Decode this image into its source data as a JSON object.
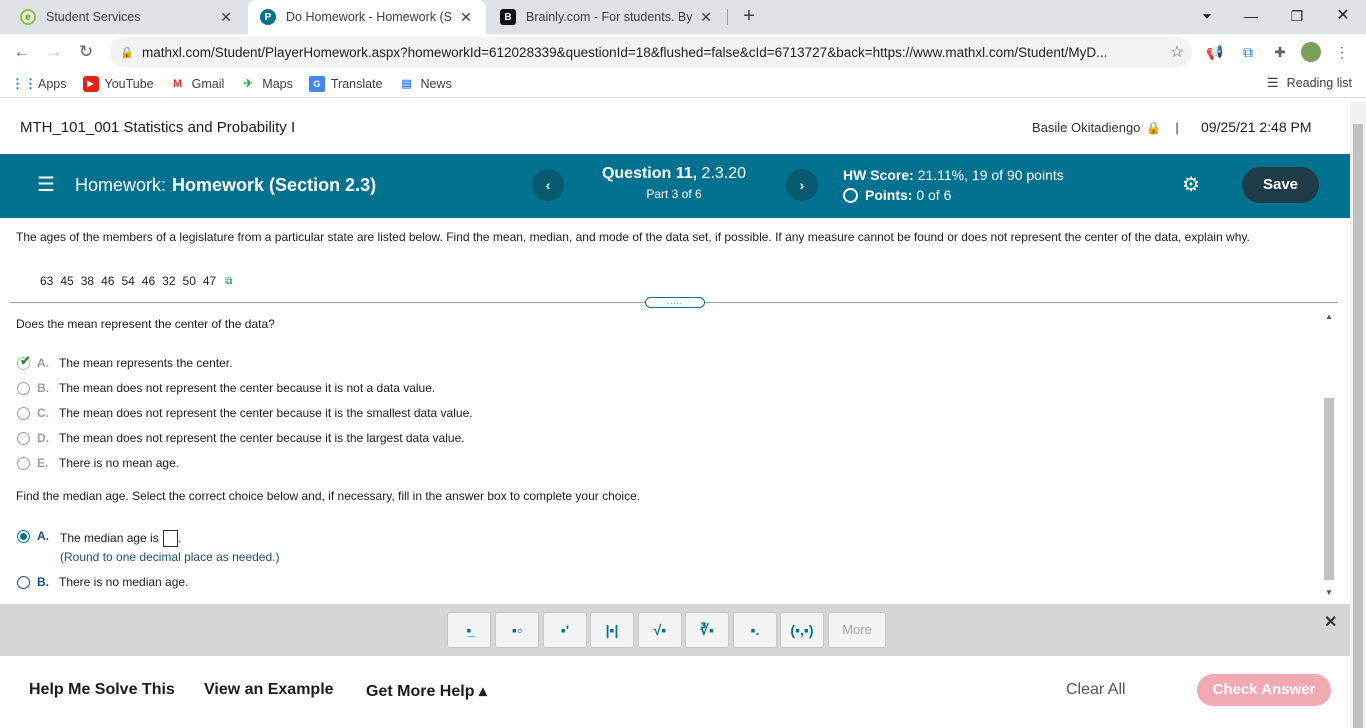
{
  "browser": {
    "tabs": [
      {
        "title": "Student Services",
        "favicon": "e"
      },
      {
        "title": "Do Homework - Homework (Sect",
        "favicon": "P"
      },
      {
        "title": "Brainly.com - For students. By stu",
        "favicon": "B"
      }
    ],
    "url": "mathxl.com/Student/PlayerHomework.aspx?homeworkId=612028339&questionId=18&flushed=false&cId=6713727&back=https://www.mathxl.com/Student/MyD...",
    "bookmarks": [
      "Apps",
      "YouTube",
      "Gmail",
      "Maps",
      "Translate",
      "News"
    ],
    "reading_list": "Reading list"
  },
  "header": {
    "course": "MTH_101_001 Statistics and Probability I",
    "user": "Basile Okitadiengo",
    "separator": "|",
    "datetime": "09/25/21 2:48 PM"
  },
  "hwbar": {
    "label": "Homework:",
    "name": "Homework (Section 2.3)",
    "question_label": "Question 11,",
    "question_ref": "2.3.20",
    "part": "Part 3 of 6",
    "score_label": "HW Score:",
    "score_value": "21.11%, 19 of 90 points",
    "points_label": "Points:",
    "points_value": "0 of 6",
    "save": "Save"
  },
  "question": {
    "text": "The ages of the members of a legislature from a particular state are listed below. Find the mean, median, and mode of the data set, if possible. If any measure cannot be found or does not represent the center of the data, explain why.",
    "data": [
      "63",
      "45",
      "38",
      "46",
      "54",
      "46",
      "32",
      "50",
      "47"
    ],
    "handle": "....."
  },
  "part_mean": {
    "prompt": "Does the mean represent the center of the data?",
    "choices": [
      {
        "letter": "A.",
        "text": "The mean represents the center."
      },
      {
        "letter": "B.",
        "text": "The mean does not represent the center because it is not a data value."
      },
      {
        "letter": "C.",
        "text": "The mean does not represent the center because it is the smallest data value."
      },
      {
        "letter": "D.",
        "text": "The mean does not represent the center because it is the largest data value."
      },
      {
        "letter": "E.",
        "text": "There is no mean age."
      }
    ]
  },
  "part_median": {
    "prompt": "Find the median age. Select the correct choice below and, if necessary, fill in the answer box to complete your choice.",
    "choices": [
      {
        "letter": "A.",
        "text": "The median age is",
        "suffix": "."
      },
      {
        "letter": "B.",
        "text": "There is no median age."
      }
    ],
    "hint": "(Round to one decimal place as needed.)"
  },
  "math_toolbar": {
    "buttons": [
      "▪̲",
      "▪▫",
      "▪'",
      "|▪|",
      "√▪",
      "∛▪",
      "▪.",
      "(▪,▪)"
    ],
    "more": "More"
  },
  "footer": {
    "help": "Help Me Solve This",
    "example": "View an Example",
    "more_help": "Get More Help ▴",
    "clear": "Clear All",
    "check": "Check Answer"
  },
  "colors": {
    "brand": "#00728f",
    "save_bg": "#1e3b47",
    "check_bg": "#f1a9b4"
  }
}
